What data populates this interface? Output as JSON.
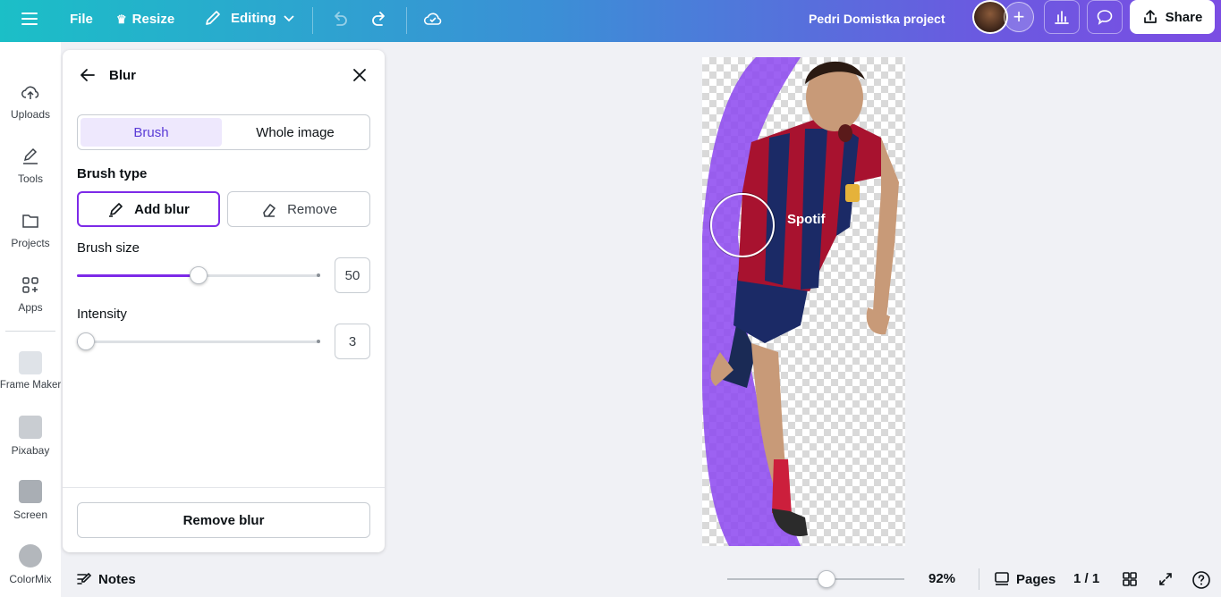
{
  "topbar": {
    "file_label": "File",
    "resize_label": "Resize",
    "editing_label": "Editing",
    "project_title": "Pedri Domistka project",
    "share_label": "Share"
  },
  "rail": {
    "items": [
      {
        "label": "Uploads",
        "icon": "cloud-upload-icon"
      },
      {
        "label": "Tools",
        "icon": "pen-tool-icon"
      },
      {
        "label": "Projects",
        "icon": "folder-icon"
      },
      {
        "label": "Apps",
        "icon": "apps-grid-icon"
      },
      {
        "label": "Frame Maker",
        "icon": "app-thumbnail"
      },
      {
        "label": "Pixabay",
        "icon": "app-thumbnail"
      },
      {
        "label": "Screen",
        "icon": "app-thumbnail"
      },
      {
        "label": "ColorMix",
        "icon": "app-thumbnail"
      }
    ]
  },
  "panel": {
    "title": "Blur",
    "tabs": [
      {
        "label": "Brush",
        "active": true
      },
      {
        "label": "Whole image",
        "active": false
      }
    ],
    "brush_type_label": "Brush type",
    "add_blur_label": "Add blur",
    "remove_label": "Remove",
    "brush_size_label": "Brush size",
    "brush_size_value": "50",
    "brush_size_fraction": 0.5,
    "intensity_label": "Intensity",
    "intensity_value": "3",
    "intensity_fraction": 0.03,
    "remove_blur_label": "Remove blur"
  },
  "bottombar": {
    "notes_label": "Notes",
    "zoom_value": "92%",
    "zoom_fraction": 0.56,
    "pages_label": "Pages",
    "page_indicator": "1 / 1"
  },
  "colors": {
    "accent": "#7d2ae8",
    "blur_overlay": "#8c46f0"
  }
}
